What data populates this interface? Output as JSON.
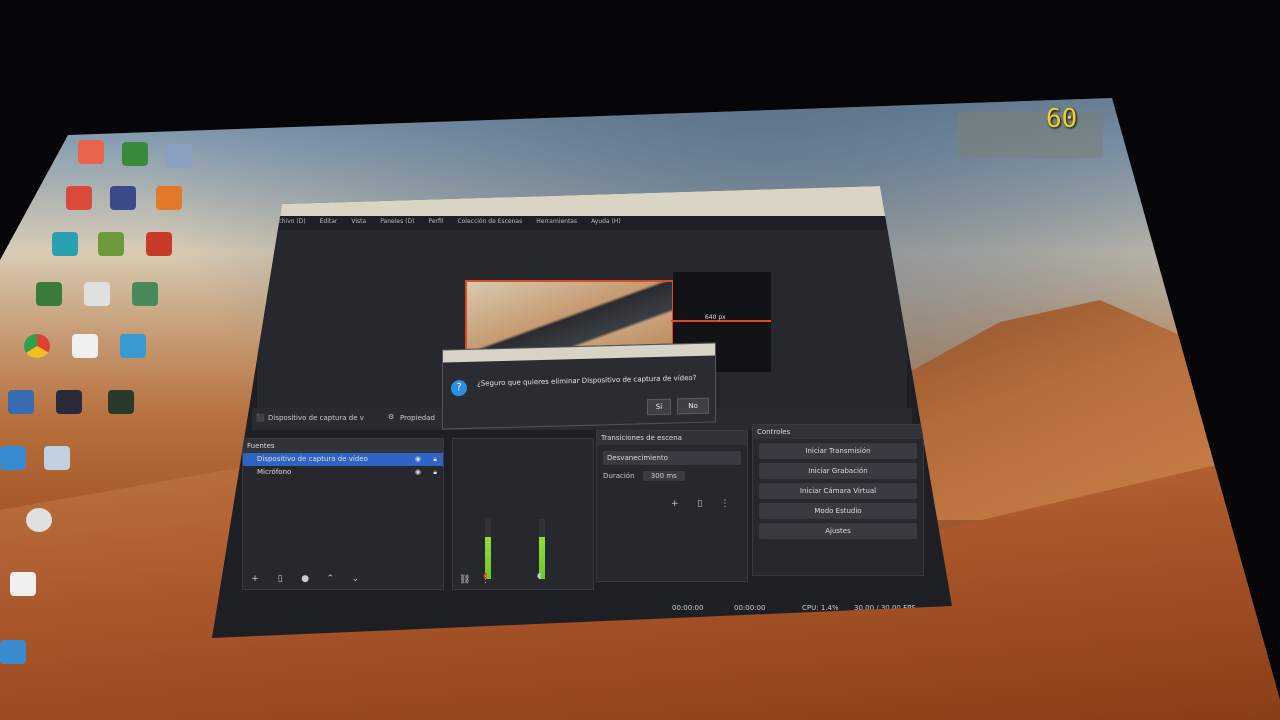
{
  "overlay": {
    "fps_counter": "60"
  },
  "obs": {
    "menu": [
      "Archivo (D)",
      "Editar",
      "Vista",
      "Paneles (D)",
      "Perfil",
      "Colección de Escenas",
      "Herramientas",
      "Ayuda (H)"
    ],
    "preview": {
      "canvas_label": "640 px"
    },
    "source_bar": {
      "selected_source": "Dispositivo de captura de v",
      "properties_label": "Propiedad"
    },
    "sources_panel": {
      "title": "Fuentes",
      "items": [
        {
          "label": "Dispositivo de captura de vídeo",
          "selected": true
        },
        {
          "label": "Micrófono",
          "selected": false
        }
      ]
    },
    "transitions_panel": {
      "title": "Transiciones de escena",
      "transition": "Desvanecimiento",
      "duration_label": "Duración",
      "duration_value": "300 ms"
    },
    "controls_panel": {
      "title": "Controles",
      "buttons": [
        "Iniciar Transmisión",
        "Iniciar Grabación",
        "Iniciar Cámara Virtual",
        "Modo Estudio",
        "Ajustes"
      ]
    },
    "status": {
      "cpu": "CPU: 1.4%",
      "fps": "30.00 / 30.00 FPS",
      "timer1": "00:00:00",
      "timer2": "00:00:00"
    },
    "dialog": {
      "message": "¿Seguro que quieres eliminar Dispositivo de captura de vídeo?",
      "yes_label": "Sí",
      "no_label": "No"
    }
  }
}
